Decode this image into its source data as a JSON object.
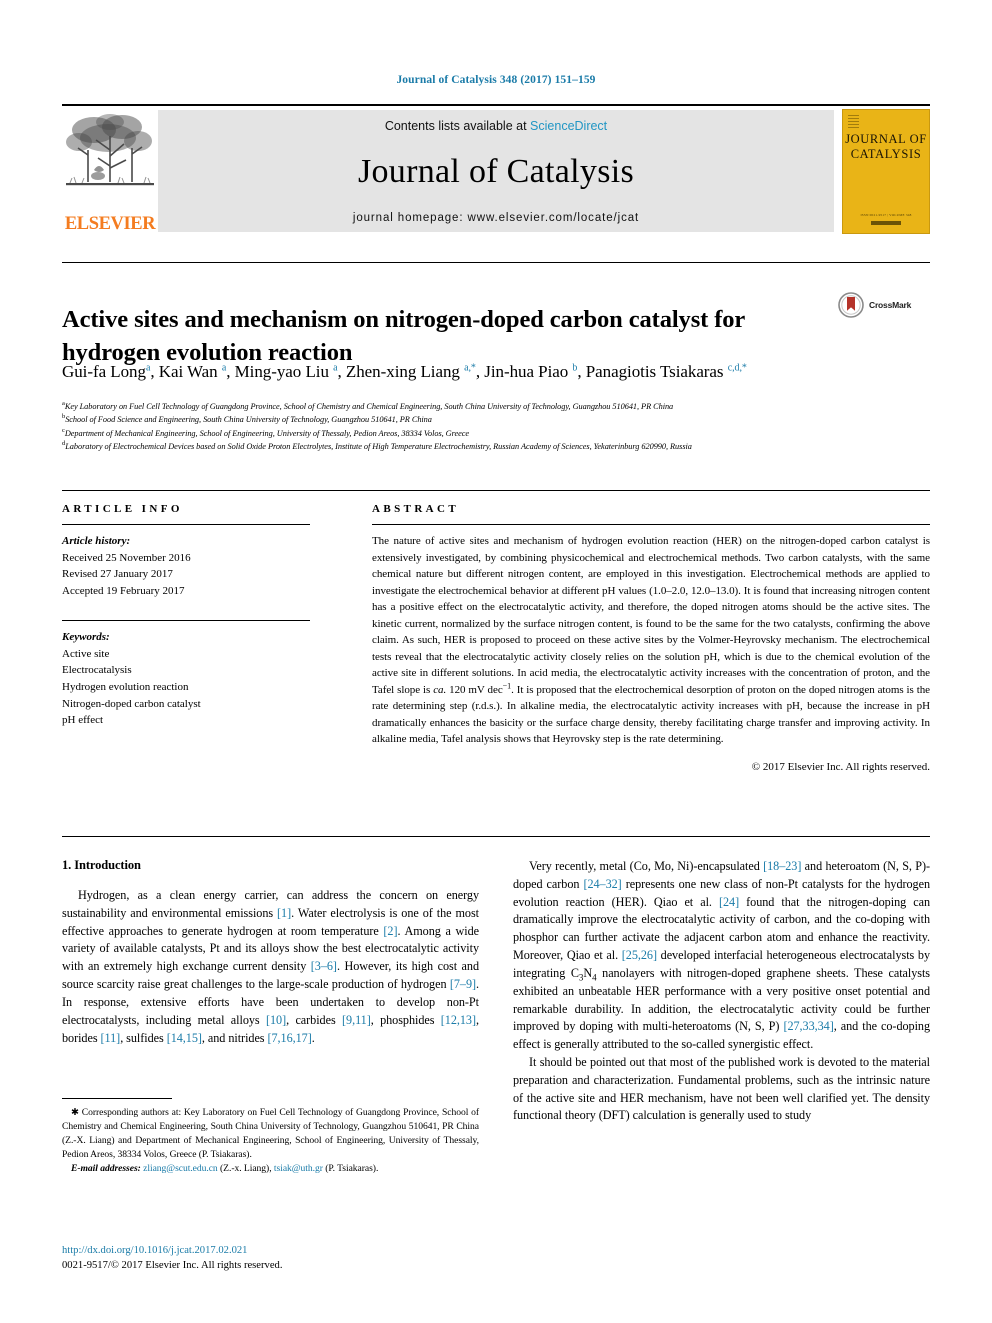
{
  "running_head": "Journal of Catalysis 348 (2017) 151–159",
  "masthead": {
    "publisher_logo_label": "ELSEVIER",
    "contents_prefix": "Contents lists available at",
    "contents_link": "ScienceDirect",
    "journal_name": "Journal of Catalysis",
    "homepage": "journal homepage: www.elsevier.com/locate/jcat",
    "cover": {
      "line1": "JOURNAL OF",
      "line2": "CATALYSIS",
      "footer": "ISSN 0021-9517 | VOLUME 348"
    }
  },
  "article": {
    "title": "Active sites and mechanism on nitrogen-doped carbon catalyst for hydrogen evolution reaction",
    "crossmark_label": "CrossMark",
    "authors_html": "Gui-fa Long<sup>a</sup>, Kai Wan <sup>a</sup>, Ming-yao Liu <sup>a</sup>, Zhen-xing Liang <sup>a,*</sup>, Jin-hua Piao <sup>b</sup>, Panagiotis Tsiakaras <sup>c,d,*</sup>",
    "affiliations": [
      "Key Laboratory on Fuel Cell Technology of Guangdong Province, School of Chemistry and Chemical Engineering, South China University of Technology, Guangzhou 510641, PR China",
      "School of Food Science and Engineering, South China University of Technology, Guangzhou 510641, PR China",
      "Department of Mechanical Engineering, School of Engineering, University of Thessaly, Pedion Areos, 38334 Volos, Greece",
      "Laboratory of Electrochemical Devices based on Solid Oxide Proton Electrolytes, Institute of High Temperature Electrochemistry, Russian Academy of Sciences, Yekaterinburg 620990, Russia"
    ],
    "affiliation_marks": [
      "a",
      "b",
      "c",
      "d"
    ]
  },
  "article_info": {
    "heading": "ARTICLE INFO",
    "history_label": "Article history:",
    "history": [
      "Received 25 November 2016",
      "Revised 27 January 2017",
      "Accepted 19 February 2017"
    ],
    "keywords_label": "Keywords:",
    "keywords": [
      "Active site",
      "Electrocatalysis",
      "Hydrogen evolution reaction",
      "Nitrogen-doped carbon catalyst",
      "pH effect"
    ]
  },
  "abstract": {
    "heading": "ABSTRACT",
    "text_html": "The nature of active sites and mechanism of hydrogen evolution reaction (HER) on the nitrogen-doped carbon catalyst is extensively investigated, by combining physicochemical and electrochemical methods. Two carbon catalysts, with the same chemical nature but different nitrogen content, are employed in this investigation. Electrochemical methods are applied to investigate the electrochemical behavior at different pH values (1.0&ndash;2.0, 12.0&ndash;13.0). It is found that increasing nitrogen content has a positive effect on the electrocatalytic activity, and therefore, the doped nitrogen atoms should be the active sites. The kinetic current, normalized by the surface nitrogen content, is found to be the same for the two catalysts, confirming the above claim. As such, HER is proposed to proceed on these active sites by the Volmer-Heyrovsky mechanism. The electrochemical tests reveal that the electrocatalytic activity closely relies on the solution pH, which is due to the chemical evolution of the active site in different solutions. In acid media, the electrocatalytic activity increases with the concentration of proton, and the Tafel slope is <i>ca.</i> 120 mV dec<sup>&minus;1</sup>. It is proposed that the electrochemical desorption of proton on the doped nitrogen atoms is the rate determining step (r.d.s.). In alkaline media, the electrocatalytic activity increases with pH, because the increase in pH dramatically enhances the basicity or the surface charge density, thereby facilitating charge transfer and improving activity. In alkaline media, Tafel analysis shows that Heyrovsky step is the rate determining.",
    "copyright": "© 2017 Elsevier Inc. All rights reserved."
  },
  "body": {
    "section_title": "1. Introduction",
    "left_paragraphs_html": [
      "Hydrogen, as a clean energy carrier, can address the concern on energy sustainability and environmental emissions <span class=\"ref\">[1]</span>. Water electrolysis is one of the most effective approaches to generate hydrogen at room temperature <span class=\"ref\">[2]</span>. Among a wide variety of available catalysts, Pt and its alloys show the best electrocatalytic activity with an extremely high exchange current density <span class=\"ref\">[3&ndash;6]</span>. However, its high cost and source scarcity raise great challenges to the large-scale production of hydrogen <span class=\"ref\">[7&ndash;9]</span>. In response, extensive efforts have been undertaken to develop non-Pt electrocatalysts, including metal alloys <span class=\"ref\">[10]</span>, carbides <span class=\"ref\">[9,11]</span>, phosphides <span class=\"ref\">[12,13]</span>, borides <span class=\"ref\">[11]</span>, sulfides <span class=\"ref\">[14,15]</span>, and nitrides <span class=\"ref\">[7,16,17]</span>."
    ],
    "right_paragraphs_html": [
      "Very recently, metal (Co, Mo, Ni)-encapsulated <span class=\"ref\">[18&ndash;23]</span> and heteroatom (N, S, P)-doped carbon <span class=\"ref\">[24&ndash;32]</span> represents one new class of non-Pt catalysts for the hydrogen evolution reaction (HER). Qiao et al. <span class=\"ref\">[24]</span> found that the nitrogen-doping can dramatically improve the electrocatalytic activity of carbon, and the co-doping with phosphor can further activate the adjacent carbon atom and enhance the reactivity. Moreover, Qiao et al. <span class=\"ref\">[25,26]</span> developed interfacial heterogeneous electrocatalysts by integrating C<span class=\"sub\">3</span>N<span class=\"sub\">4</span> nanolayers with nitrogen-doped graphene sheets. These catalysts exhibited an unbeatable HER performance with a very positive onset potential and remarkable durability. In addition, the electrocatalytic activity could be further improved by doping with multi-heteroatoms (N, S, P) <span class=\"ref\">[27,33,34]</span>, and the co-doping effect is generally attributed to the so-called synergistic effect.",
      "It should be pointed out that most of the published work is devoted to the material preparation and characterization. Fundamental problems, such as the intrinsic nature of the active site and HER mechanism, have not been well clarified yet. The density functional theory (DFT) calculation is generally used to study"
    ]
  },
  "footnotes": {
    "corresponding_html": "<span class=\"star\">&#10033;</span> Corresponding authors at: Key Laboratory on Fuel Cell Technology of Guangdong Province, School of Chemistry and Chemical Engineering, South China University of Technology, Guangzhou 510641, PR China (Z.-X. Liang) and Department of Mechanical Engineering, School of Engineering, University of Thessaly, Pedion Areos, 38334 Volos, Greece (P. Tsiakaras).",
    "email_html": "<span class=\"email-label\">E-mail addresses:</span> <span class=\"link\">zliang@scut.edu.cn</span> (Z.-x. Liang), <span class=\"link\">tsiak@uth.gr</span> (P. Tsiakaras)."
  },
  "doi_block": {
    "doi": "http://dx.doi.org/10.1016/j.jcat.2017.02.021",
    "issn_line": "0021-9517/© 2017 Elsevier Inc. All rights reserved."
  },
  "colors": {
    "link_blue": "#1a7ba8",
    "sciencedirect_blue": "#2196c4",
    "elsevier_orange": "#F47C20",
    "cover_yellow": "#E9B417",
    "masthead_gray": "#e4e4e4",
    "crossmark_red": "#b5332a"
  }
}
